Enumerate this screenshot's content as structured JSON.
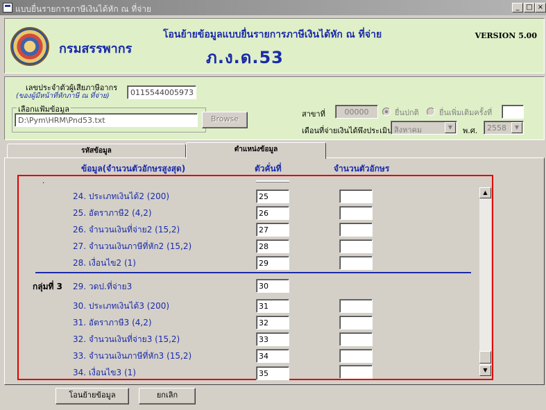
{
  "window": {
    "title": "แบบยื่นรายการภาษีเงินได้หัก ณ ที่จ่าย",
    "minimize": "_",
    "maximize": "□",
    "close": "×"
  },
  "header": {
    "org_name": "กรมสรรพากร",
    "title": "โอนย้ายข้อมูลแบบยื่นรายการภาษีเงินได้หัก ณ ที่จ่าย",
    "form_code": "ภ.ง.ด.53",
    "version": "VERSION 5.00"
  },
  "info": {
    "taxid_label": "เลขประจำตัวผู้เสียภาษีอากร",
    "taxid_sublabel": "(ของผู้มีหน้าที่หักภาษี ณ ที่จ่าย)",
    "taxid_value": "0115544005973",
    "file_group_label": "เลือกแฟ้มข้อมูล",
    "file_path": "D:\\Pym\\HRM\\Pnd53.txt",
    "browse_label": "Browse",
    "branch_label": "สาขาที่",
    "branch_value": "00000",
    "radio_normal": "ยื่นปกติ",
    "radio_additional": "ยื่นเพิ่มเติมครั้งที่",
    "additional_value": "",
    "month_label": "เดือนที่จ่ายเงินได้พึงประเมิน",
    "month_value": "สิงหาคม",
    "year_label": "พ.ศ.",
    "year_value": "2558"
  },
  "tabs": [
    {
      "label": "รหัสข้อมูล"
    },
    {
      "label": "ตำแหน่งข้อมูล"
    }
  ],
  "columns": {
    "data": "ข้อมูล(จำนวนตัวอักษรสูงสุด)",
    "position": "ตัวคั่นที่",
    "length": "จำนวนตัวอักษร"
  },
  "rows": [
    {
      "label": "24. ประเภทเงินได้2 (200)",
      "position": "25",
      "length": ""
    },
    {
      "label": "25. อัตราภาษี2 (4,2)",
      "position": "26",
      "length": ""
    },
    {
      "label": "26. จำนวนเงินที่จ่าย2 (15,2)",
      "position": "27",
      "length": ""
    },
    {
      "label": "27. จำนวนเงินภาษีที่หัก2 (15,2)",
      "position": "28",
      "length": ""
    },
    {
      "label": "28. เงื่อนไข2 (1)",
      "position": "29",
      "length": ""
    },
    {
      "label": "29. วดป.ที่จ่าย3",
      "position": "30",
      "length": ""
    },
    {
      "label": "30. ประเภทเงินได้3 (200)",
      "position": "31",
      "length": ""
    },
    {
      "label": "31. อัตราภาษี3 (4,2)",
      "position": "32",
      "length": ""
    },
    {
      "label": "32. จำนวนเงินที่จ่าย3 (15,2)",
      "position": "33",
      "length": ""
    },
    {
      "label": "33. จำนวนเงินภาษีที่หัก3 (15,2)",
      "position": "34",
      "length": ""
    },
    {
      "label": "34. เงื่อนไข3 (1)",
      "position": "35",
      "length": ""
    }
  ],
  "group3_label": "กลุ่มที่ 3",
  "buttons": {
    "transfer": "โอนย้ายข้อมูล",
    "cancel": "ยกเลิก"
  }
}
